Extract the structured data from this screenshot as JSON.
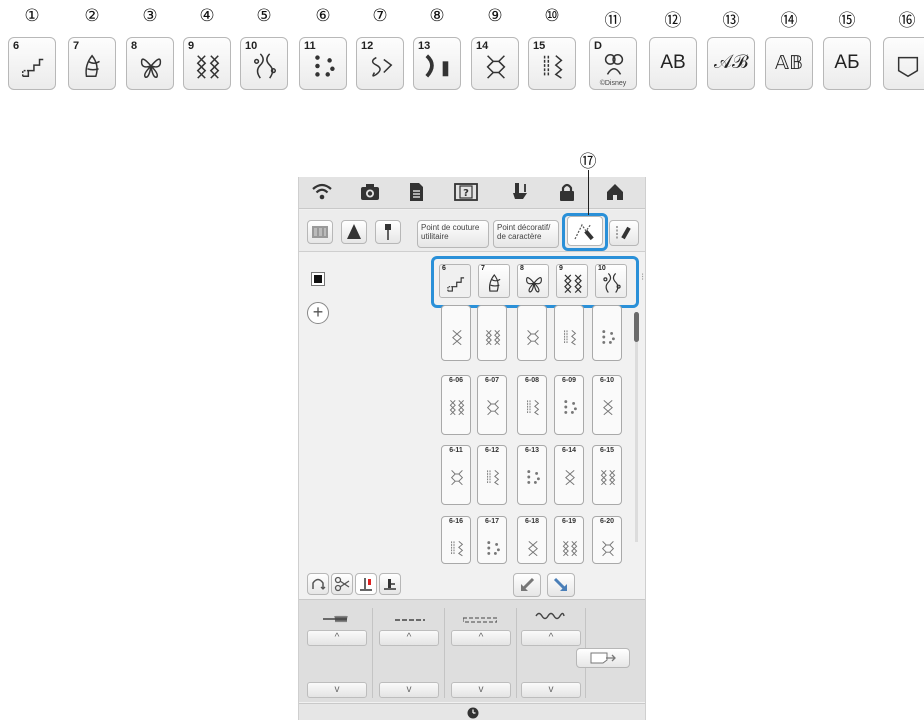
{
  "legend": [
    "①",
    "②",
    "③",
    "④",
    "⑤",
    "⑥",
    "⑦",
    "⑧",
    "⑨",
    "⑩",
    "⑪",
    "⑫",
    "⑬",
    "⑭",
    "⑮",
    "⑯"
  ],
  "callout17": "⑰",
  "categories": [
    {
      "num": "6",
      "icon": "stairs-stitch-icon"
    },
    {
      "num": "7",
      "icon": "leaf-stitch-icon"
    },
    {
      "num": "8",
      "icon": "butterfly-stitch-icon"
    },
    {
      "num": "9",
      "icon": "cross-stitch-icon"
    },
    {
      "num": "10",
      "icon": "vine-stitch-icon"
    },
    {
      "num": "11",
      "icon": "dot-stitch-icon"
    },
    {
      "num": "12",
      "icon": "swirl-stitch-icon"
    },
    {
      "num": "13",
      "icon": "satin-stitch-icon"
    },
    {
      "num": "14",
      "icon": "zigzag-cross-icon"
    },
    {
      "num": "15",
      "icon": "line-stitch-icon"
    },
    {
      "num": "D",
      "icon": "disney-icon",
      "sub": "©Disney"
    },
    {
      "text": "AB",
      "icon": "gothic-font-icon"
    },
    {
      "text": "𝒜ℬ",
      "icon": "script-font-icon"
    },
    {
      "text": "𝔸𝔹",
      "icon": "outline-font-icon"
    },
    {
      "text": "АБ",
      "icon": "cyrillic-font-icon"
    },
    {
      "icon": "pocket-icon"
    }
  ],
  "device": {
    "topbar_icons": [
      "wifi-icon",
      "camera-icon",
      "document-icon",
      "help-icon",
      "presser-foot-icon",
      "lock-icon",
      "home-icon"
    ],
    "mode_utility": "Point de couture utilitaire",
    "mode_decorative": "Point décoratif/ de caractère",
    "tabs": [
      "6",
      "7",
      "8",
      "9",
      "10"
    ],
    "grid": [
      [
        "",
        "",
        "",
        "",
        ""
      ],
      [
        "6-06",
        "6-07",
        "6-08",
        "6-09",
        "6-10"
      ],
      [
        "6-11",
        "6-12",
        "6-13",
        "6-14",
        "6-15"
      ],
      [
        "6-16",
        "6-17",
        "6-18",
        "6-19",
        "6-20"
      ]
    ],
    "accent": "#2a90d8"
  }
}
